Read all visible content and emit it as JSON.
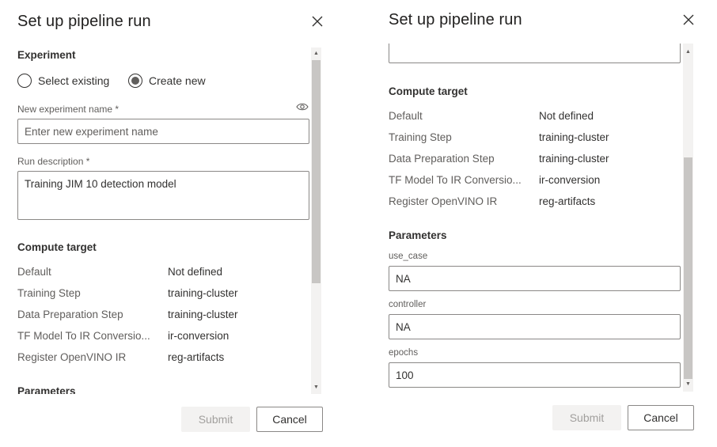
{
  "left": {
    "title": "Set up pipeline run",
    "experiment": {
      "heading": "Experiment",
      "option_existing": "Select existing",
      "option_new": "Create new",
      "selected": "Create new",
      "name_label": "New experiment name *",
      "name_placeholder": "Enter new experiment name",
      "description_label": "Run description *",
      "description_value": "Training JIM 10 detection model"
    },
    "compute": {
      "heading": "Compute target",
      "rows": [
        {
          "label": "Default",
          "value": "Not defined"
        },
        {
          "label": "Training Step",
          "value": "training-cluster"
        },
        {
          "label": "Data Preparation Step",
          "value": "training-cluster"
        },
        {
          "label": "TF Model To IR Conversio...",
          "value": "ir-conversion"
        },
        {
          "label": "Register OpenVINO IR",
          "value": "reg-artifacts"
        }
      ]
    },
    "parameters_heading": "Parameters",
    "submit_label": "Submit",
    "cancel_label": "Cancel"
  },
  "right": {
    "title": "Set up pipeline run",
    "compute": {
      "heading": "Compute target",
      "rows": [
        {
          "label": "Default",
          "value": "Not defined"
        },
        {
          "label": "Training Step",
          "value": "training-cluster"
        },
        {
          "label": "Data Preparation Step",
          "value": "training-cluster"
        },
        {
          "label": "TF Model To IR Conversio...",
          "value": "ir-conversion"
        },
        {
          "label": "Register OpenVINO IR",
          "value": "reg-artifacts"
        }
      ]
    },
    "parameters": {
      "heading": "Parameters",
      "fields": [
        {
          "label": "use_case",
          "value": "NA"
        },
        {
          "label": "controller",
          "value": "NA"
        },
        {
          "label": "epochs",
          "value": "100"
        }
      ]
    },
    "submit_label": "Submit",
    "cancel_label": "Cancel"
  }
}
